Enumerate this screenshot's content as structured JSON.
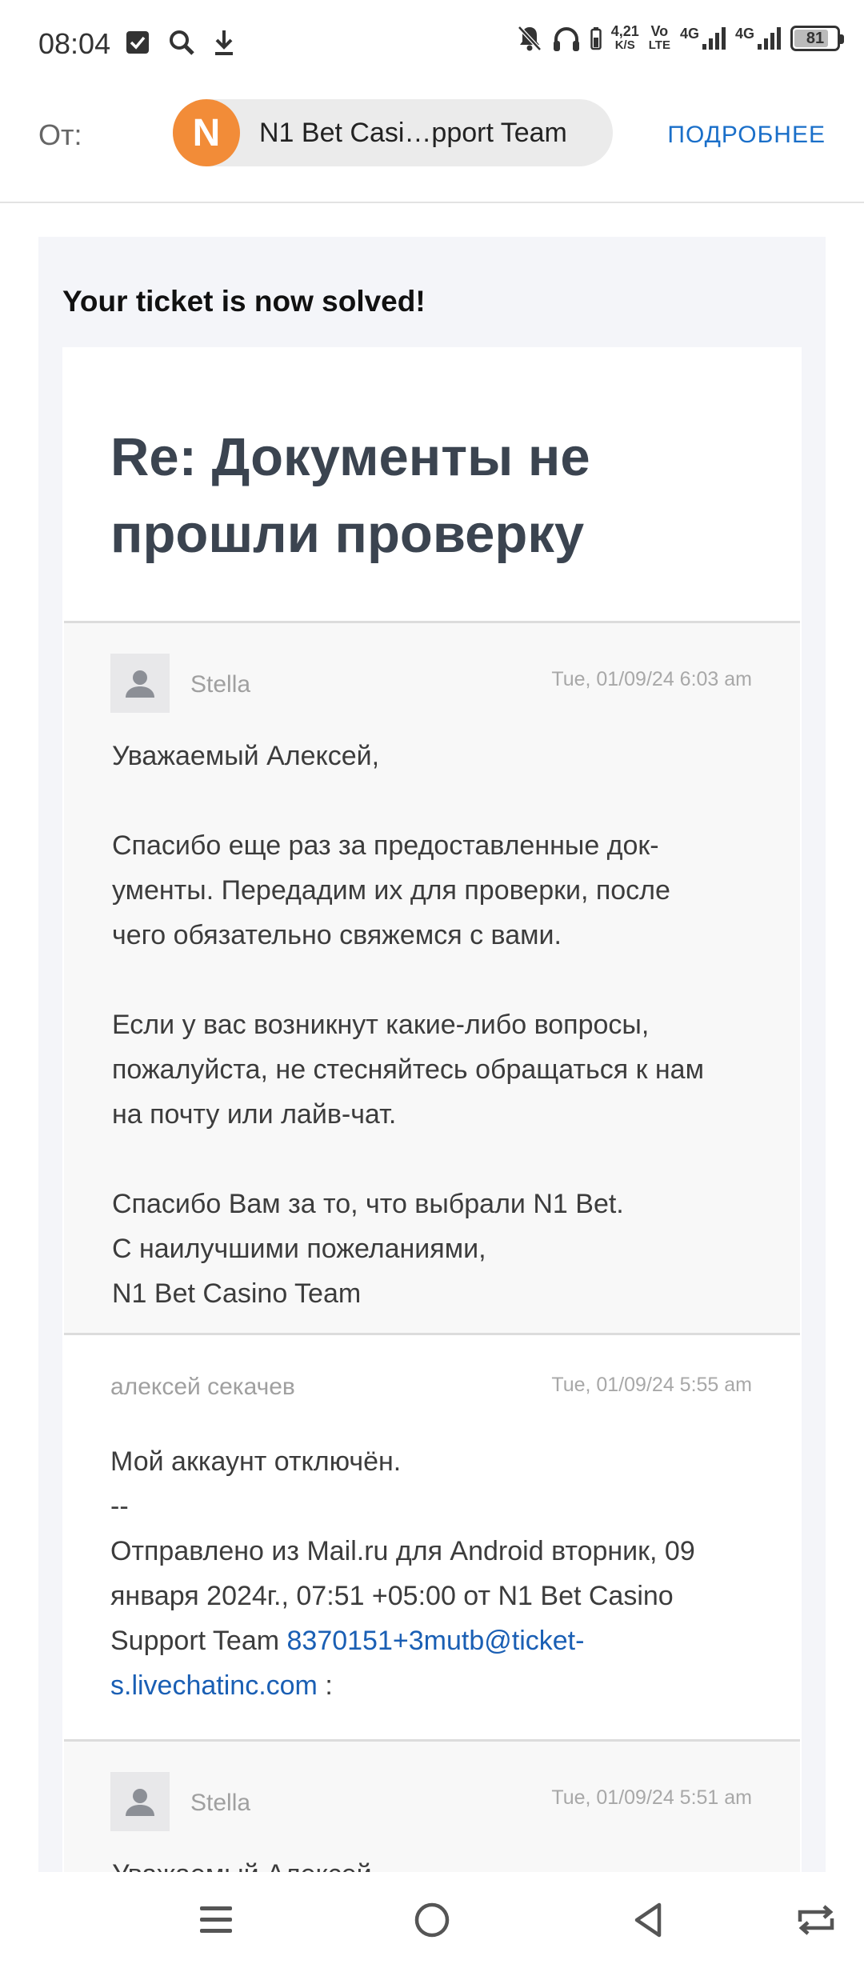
{
  "status_bar": {
    "time": "08:04",
    "net_speed_value": "4,21",
    "net_speed_unit": "K/S",
    "volte_top": "Vo",
    "volte_bottom": "LTE",
    "sim1": "4G",
    "sim2": "4G",
    "battery": "81",
    "battery_level": 0.81
  },
  "header": {
    "from_label": "От:",
    "sender_initial": "N",
    "sender_name": "N1 Bet Casi…pport Team",
    "details_link": "ПОДРОБНЕЕ"
  },
  "email": {
    "solved_title": "Your ticket is now solved!",
    "ticket_title": "Re: Документы не прошли проверку",
    "messages": [
      {
        "author": "Stella",
        "date": "Tue, 01/09/24 6:03 am",
        "greeting": "Уважаемый Алексей,",
        "para1_line1": "Спасибо еще раз за предоставленные док-",
        "para1_line2": "ументы. Передадим их для проверки, после",
        "para1_line3": "чего обязательно свяжемся с вами.",
        "para2_line1": "Если у вас возникнут какие-либо вопросы,",
        "para2_line2": "пожалуйста, не стесняйтесь обращаться к нам",
        "para2_line3": "на почту или лайв-чат.",
        "closing1": "Спасибо Вам за то, что выбрали N1 Bet.",
        "closing2": "С наилучшими пожеланиями,",
        "closing3": "N1 Bet Casino Team"
      },
      {
        "author": "алексей секачев",
        "date": "Tue, 01/09/24 5:55 am",
        "line1": "Мой аккаунт отключён.",
        "line2": "--",
        "line3": "Отправлено из Mail.ru для Android вторник, 09",
        "line4": "января 2024г., 07:51 +05:00 от N1 Bet Casino",
        "line5_prefix": "Support Team ",
        "email_link_part1": "8370151+3mutb@ticket-",
        "email_link_part2": "s.livechatinc.com",
        "line6_suffix": " :"
      },
      {
        "author": "Stella",
        "date": "Tue, 01/09/24 5:51 am",
        "greeting_partial": "Уважаемый Алексей,"
      }
    ]
  },
  "nav": {
    "icons": [
      "menu-icon",
      "home-icon",
      "back-icon",
      "rotate-icon"
    ]
  }
}
